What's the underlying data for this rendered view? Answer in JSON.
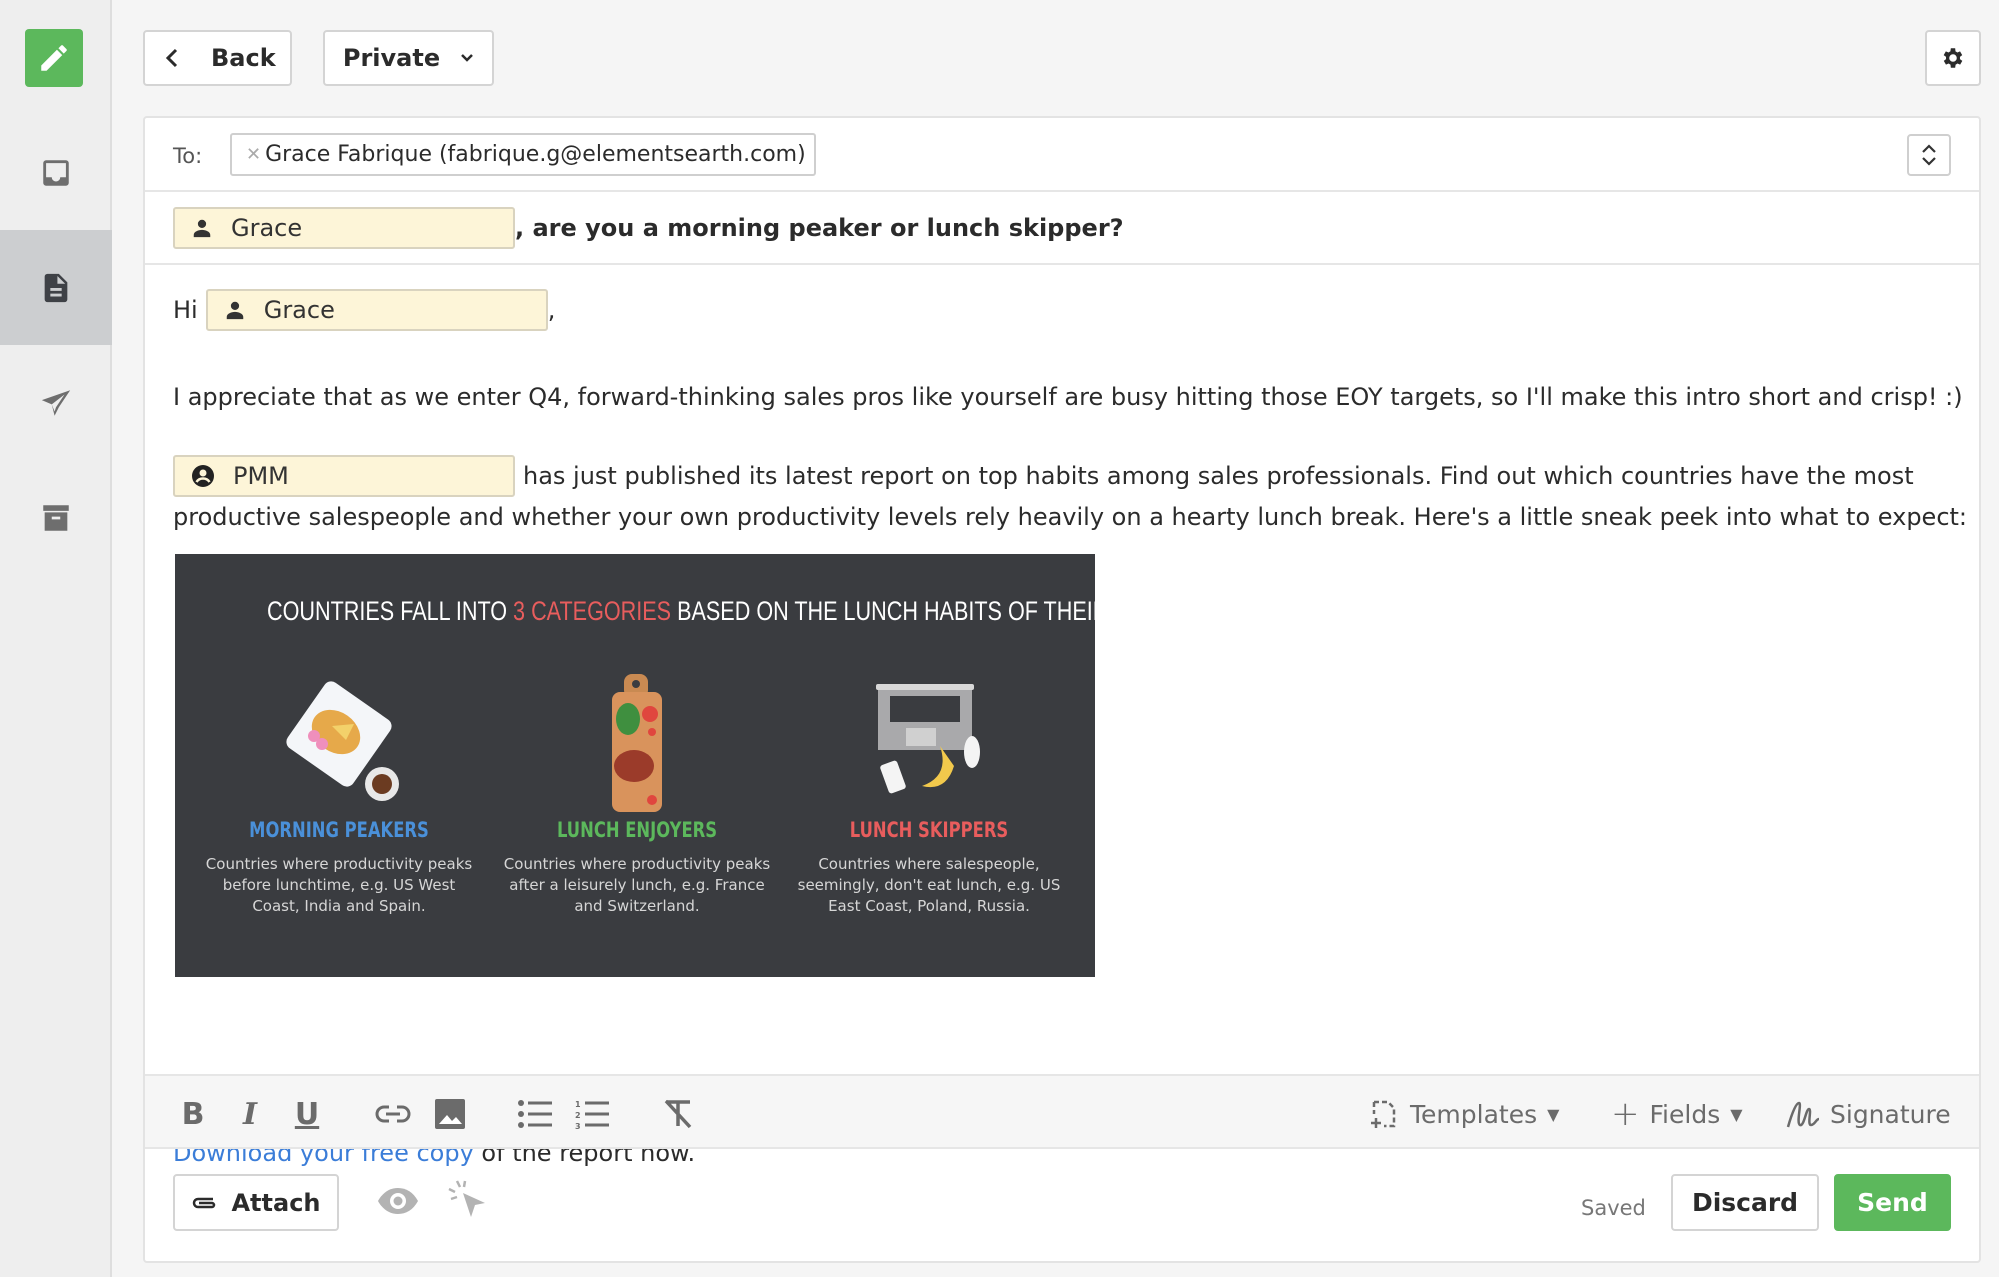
{
  "sidebar": {
    "compose_icon": "pencil-icon",
    "items": [
      {
        "name": "inbox",
        "icon": "inbox-icon",
        "active": false
      },
      {
        "name": "drafts",
        "icon": "document-icon",
        "active": true
      },
      {
        "name": "sent",
        "icon": "paper-plane-icon",
        "active": false
      },
      {
        "name": "archive",
        "icon": "archive-icon",
        "active": false
      }
    ]
  },
  "header": {
    "back_label": "Back",
    "visibility_label": "Private",
    "settings_icon": "gear-icon"
  },
  "compose": {
    "to_label": "To:",
    "recipient": "Grace Fabrique (fabrique.g@elementsearth.com)",
    "subject_merge_field": "Grace",
    "subject_text": ", are you a morning peaker or lunch skipper?",
    "greeting": "Hi",
    "greeting_merge_field": "Grace",
    "greeting_suffix": ",",
    "paragraph1": "I appreciate that as we enter Q4, forward-thinking sales pros like yourself are busy hitting those EOY targets, so I'll make this intro short and crisp! :)",
    "company_merge_field": "PMM",
    "paragraph2_line1": "has just published its latest report on top habits among sales professionals. Find out which countries have the most",
    "paragraph2_line2": "productive salespeople and whether your own productivity levels rely heavily on a hearty lunch break. Here's a little sneak peek into what to expect:",
    "link_text": "Download your free copy",
    "closing_text": " of the report now."
  },
  "infographic": {
    "title_before": "COUNTRIES FALL INTO ",
    "title_highlight": "3 CATEGORIES",
    "title_after": " BASED ON THE LUNCH HABITS OF THEIR SALESPEOPLE",
    "colors": {
      "highlight": "#e85d5d",
      "morning": "#4a90d9",
      "enjoyers": "#5cb85c",
      "skippers": "#e85d5d"
    },
    "categories": [
      {
        "title": "MORNING PEAKERS",
        "desc": "Countries where productivity peaks before lunchtime, e.g. US West Coast, India and Spain."
      },
      {
        "title": "LUNCH ENJOYERS",
        "desc": "Countries where productivity peaks after a leisurely lunch, e.g. France and Switzerland."
      },
      {
        "title": "LUNCH SKIPPERS",
        "desc": "Countries where salespeople, seemingly, don't eat lunch, e.g. US East Coast, Poland, Russia."
      }
    ]
  },
  "toolbar": {
    "bold": "B",
    "italic": "I",
    "underline": "U",
    "templates_label": "Templates",
    "fields_label": "Fields",
    "signature_label": "Signature"
  },
  "footer": {
    "attach_label": "Attach",
    "saved_status": "Saved",
    "discard_label": "Discard",
    "send_label": "Send"
  },
  "colors": {
    "brand_green": "#5cb85c",
    "link_blue": "#3b7dd8",
    "merge_bg": "#fdf5d8"
  }
}
